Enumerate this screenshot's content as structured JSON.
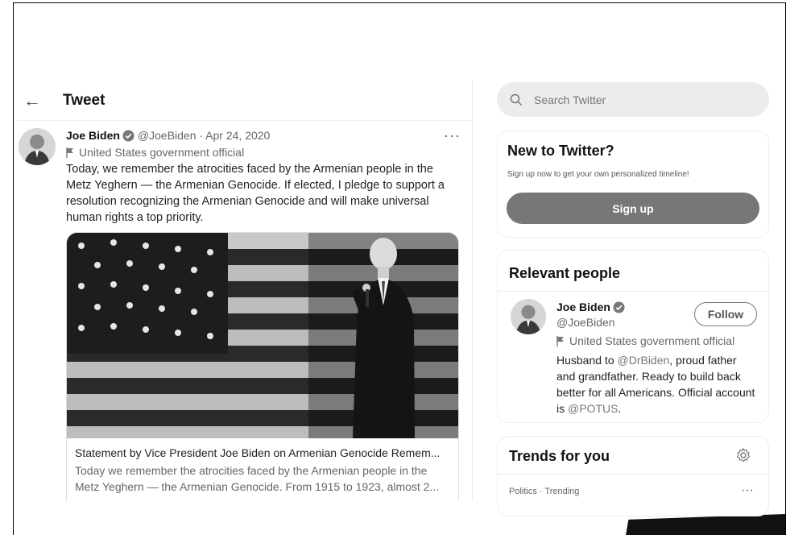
{
  "header": {
    "title": "Tweet"
  },
  "tweet": {
    "name": "Joe Biden",
    "handle_date": "@JoeBiden · Apr 24, 2020",
    "label": "United States government official",
    "text": "Today, we remember the atrocities faced by the Armenian people in the Metz Yeghern — the Armenian Genocide. If elected, I pledge to support a resolution recognizing the Armenian Genocide and will make universal human rights a top priority.",
    "more": "···",
    "card": {
      "title": "Statement by Vice President Joe Biden on Armenian Genocide Remem...",
      "desc": "Today we remember the atrocities faced by the Armenian people in the Metz Yeghern — the Armenian Genocide. From 1915 to 1923, almost 2..."
    }
  },
  "sidebar": {
    "search_placeholder": "Search Twitter",
    "new_to_twitter": {
      "title": "New to Twitter?",
      "note": "Sign up now to get your own personalized timeline!",
      "signup": "Sign up"
    },
    "relevant": {
      "title": "Relevant people",
      "name": "Joe Biden",
      "handle": "@JoeBiden",
      "follow": "Follow",
      "label": "United States government official",
      "bio_1": "Husband to ",
      "bio_mention_1": "@DrBiden",
      "bio_2": ", proud father and grandfather. Ready to build back better for all Americans. Official account is ",
      "bio_mention_2": "@POTUS",
      "bio_3": "."
    },
    "trends": {
      "title": "Trends for you",
      "item_meta": "Politics · Trending",
      "more": "···"
    }
  },
  "colors": {
    "signup_bg": "#777777",
    "text_secondary": "#666666"
  },
  "icons": [
    "back-arrow-icon",
    "verified-icon",
    "flag-icon",
    "search-icon",
    "gear-icon",
    "more-icon"
  ]
}
